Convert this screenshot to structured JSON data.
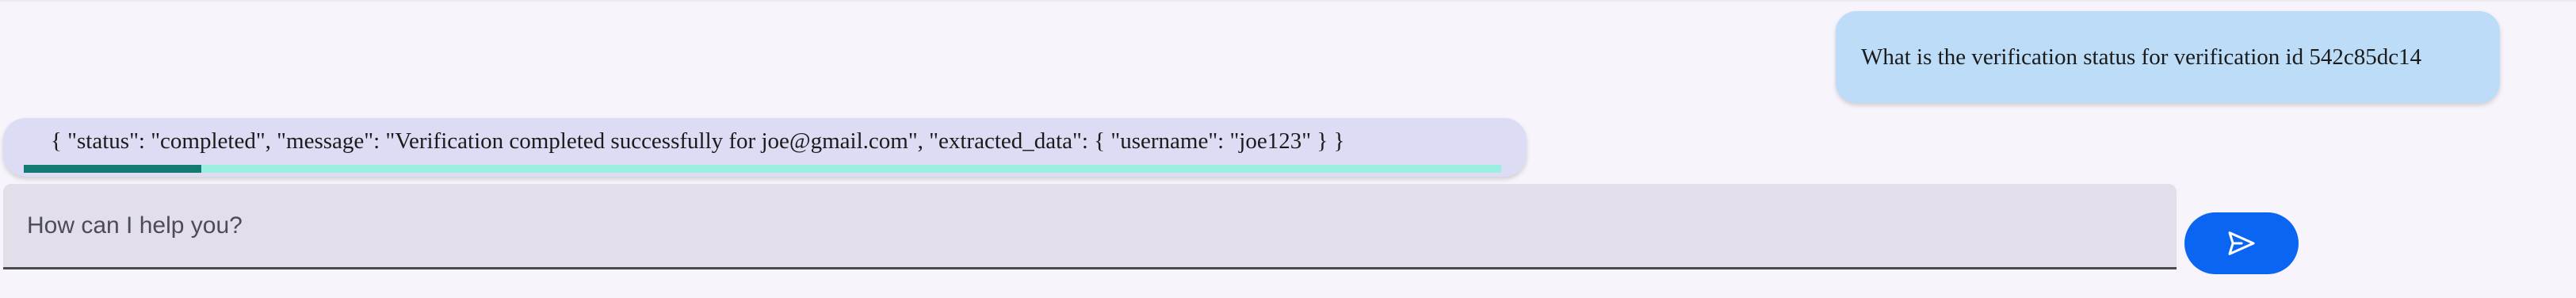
{
  "user_message": {
    "text": "What is the verification status for verification id 542c85dc14"
  },
  "bot_message": {
    "text": "{ \"status\": \"completed\", \"message\": \"Verification completed successfully for joe@gmail.com\", \"extracted_data\": { \"username\": \"joe123\" } }",
    "progress": 0.12
  },
  "composer": {
    "placeholder": "How can I help you?",
    "value": ""
  },
  "send_button": {
    "icon": "send-icon"
  },
  "colors": {
    "page_background": "#f8f4fb",
    "user_bubble": "#bcdcf8",
    "bot_bubble": "#dcdcf4",
    "progress_track": "#9ceee3",
    "progress_fill": "#127a70",
    "send_button": "#0a66f2"
  }
}
